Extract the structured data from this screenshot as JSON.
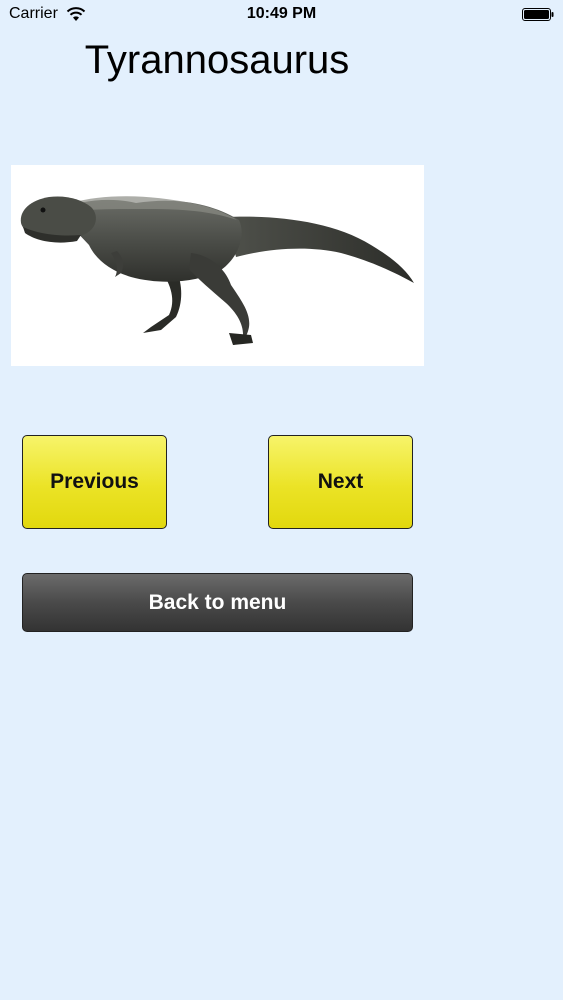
{
  "status_bar": {
    "carrier": "Carrier",
    "time": "10:49 PM",
    "wifi_icon": "wifi-icon",
    "battery_icon": "battery-full-icon"
  },
  "page": {
    "title": "Tyrannosaurus"
  },
  "image": {
    "subject": "tyrannosaurus-illustration"
  },
  "buttons": {
    "previous_label": "Previous",
    "next_label": "Next",
    "back_label": "Back to menu"
  },
  "colors": {
    "background": "#e3f0fd",
    "button_yellow": "#ebe326",
    "button_dark": "#4a4a4a"
  }
}
